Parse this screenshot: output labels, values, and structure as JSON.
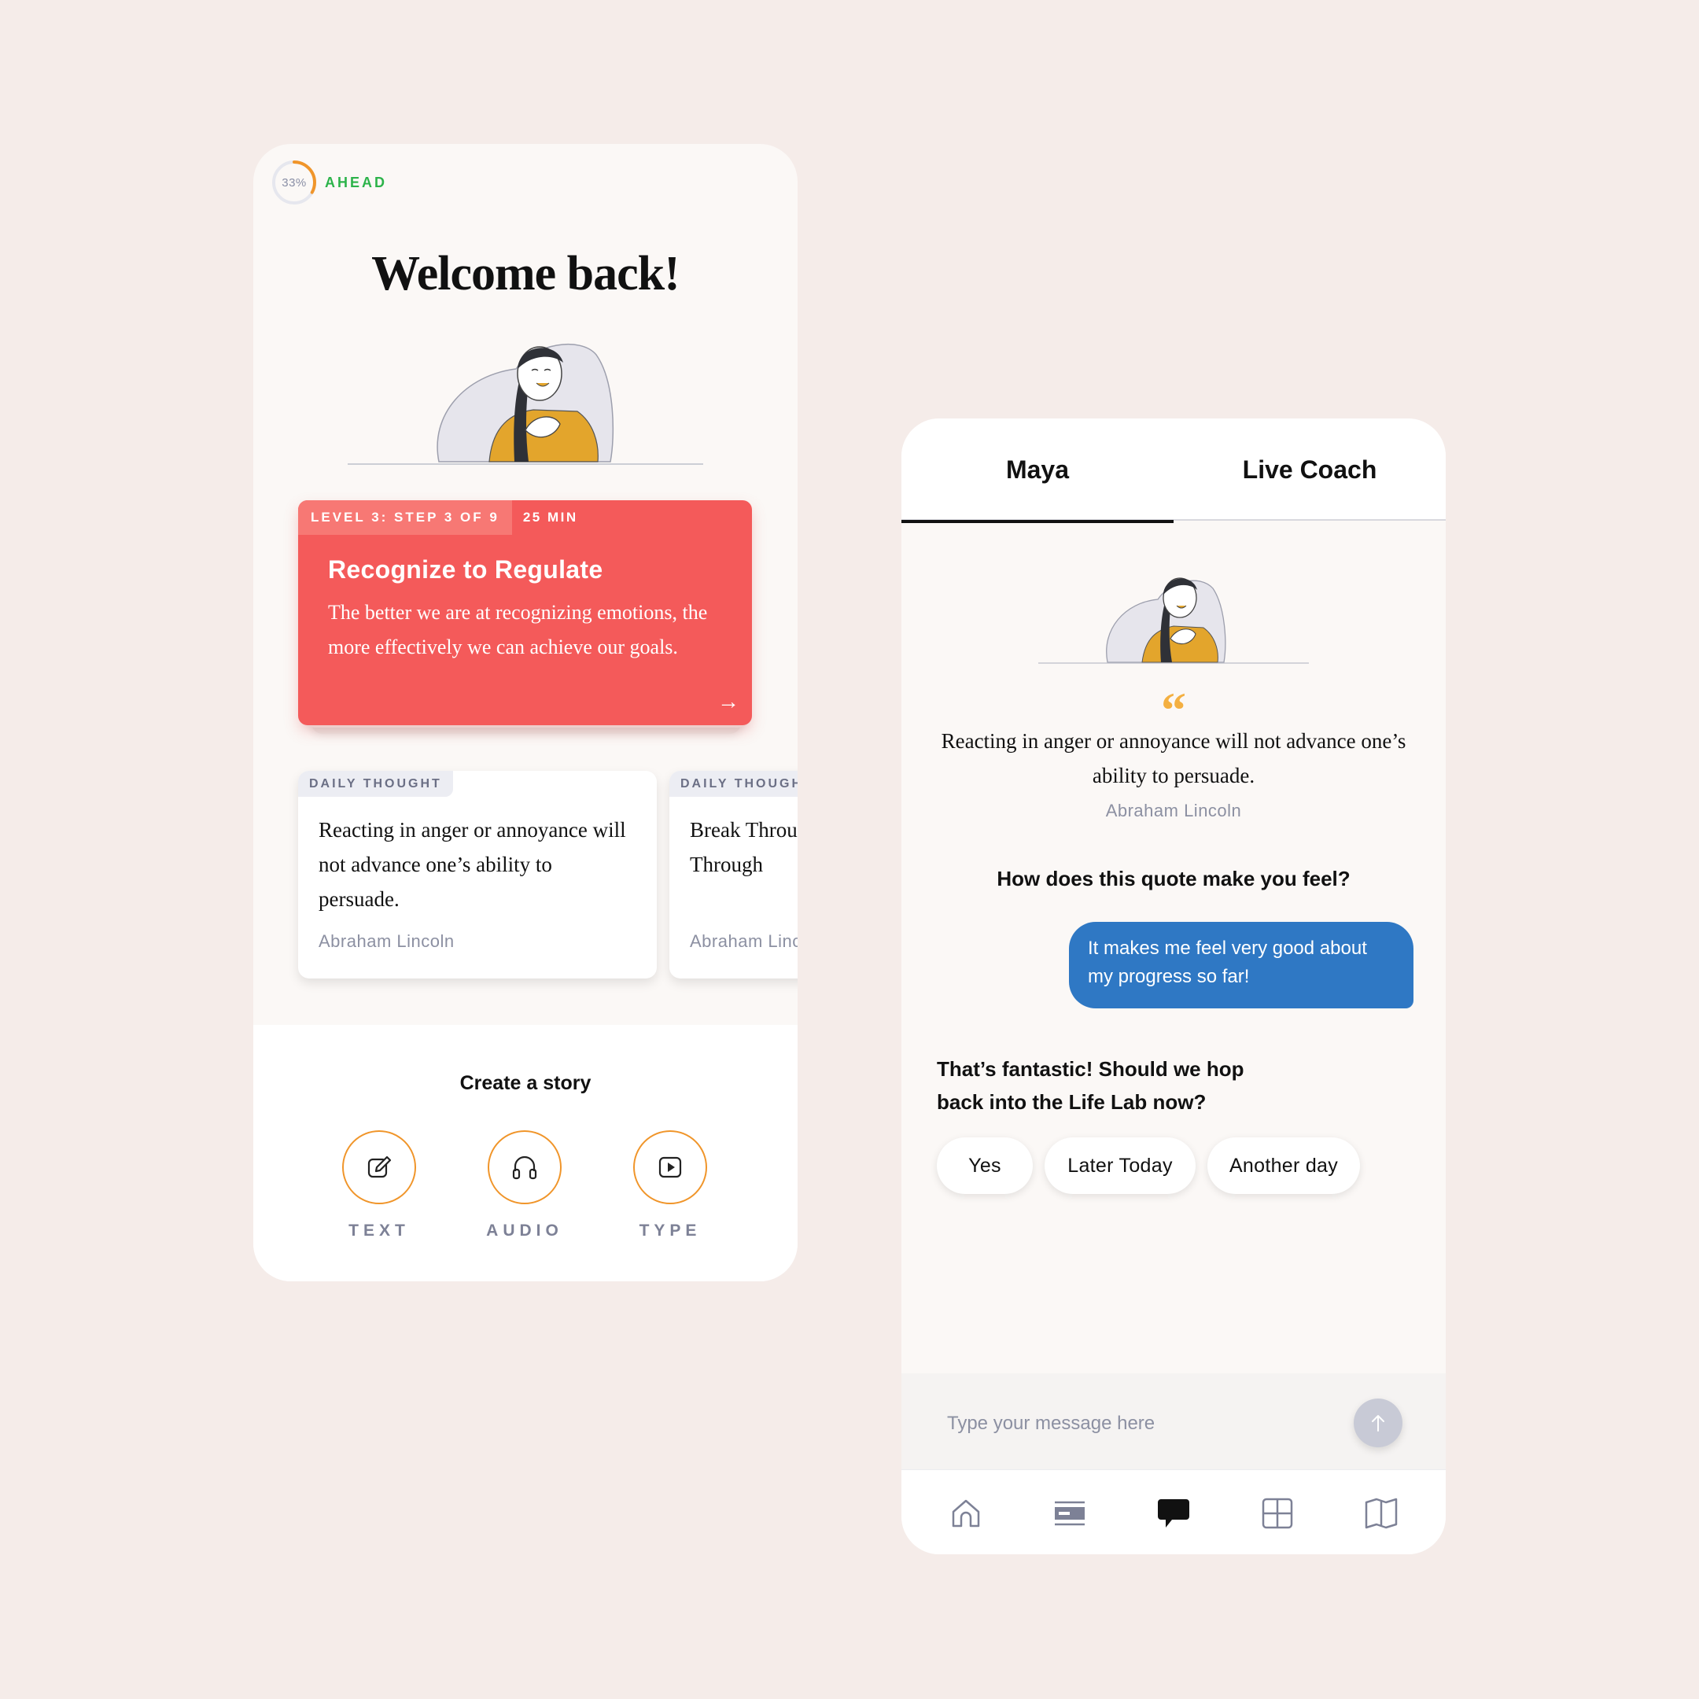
{
  "left_screen": {
    "progress": {
      "value": "33%",
      "fraction": 0.33,
      "status": "AHEAD"
    },
    "welcome_title": "Welcome back!",
    "lesson": {
      "level_step": "LEVEL 3: STEP 3 OF 9",
      "duration": "25 MIN",
      "title": "Recognize to Regulate",
      "description": "The better we are at recognizing emotions, the more effectively we can achieve our goals.",
      "arrow": "→"
    },
    "daily_thoughts": [
      {
        "tag": "DAILY THOUGHT",
        "quote": "Reacting in anger or annoyance will not advance one’s ability to persuade.",
        "author": "Abraham Lincoln"
      },
      {
        "tag": "DAILY THOUGHT",
        "quote": "Break Through Fear. Break Through",
        "author": "Abraham Lincoln"
      }
    ],
    "create_story": {
      "title": "Create a story",
      "options": [
        {
          "label": "TEXT",
          "icon": "edit-icon"
        },
        {
          "label": "AUDIO",
          "icon": "headphones-icon"
        },
        {
          "label": "TYPE",
          "icon": "play-icon"
        }
      ]
    }
  },
  "right_screen": {
    "tabs": [
      {
        "label": "Maya",
        "active": true
      },
      {
        "label": "Live Coach",
        "active": false
      }
    ],
    "quote_mark": "“",
    "quote": "Reacting in anger or annoyance will not advance one’s ability to persuade.",
    "author": "Abraham Lincoln",
    "question": "How does this quote make you feel?",
    "user_message": "It makes me feel very good about my progress so far!",
    "bot_message": "That’s fantastic! Should we hop back into the Life Lab now?",
    "quick_replies": [
      "Yes",
      "Later Today",
      "Another day"
    ],
    "composer": {
      "placeholder": "Type your message here"
    },
    "nav_items": [
      {
        "icon": "home-icon"
      },
      {
        "icon": "cards-icon"
      },
      {
        "icon": "chat-icon",
        "active": true
      },
      {
        "icon": "grid-icon"
      },
      {
        "icon": "book-icon"
      }
    ]
  },
  "colors": {
    "background": "#f5ece9",
    "accent_red": "#f45a5a",
    "accent_orange": "#f0952a",
    "ahead_green": "#2cb34a",
    "user_bubble_blue": "#2f78c4",
    "quote_gold": "#f4b041"
  }
}
